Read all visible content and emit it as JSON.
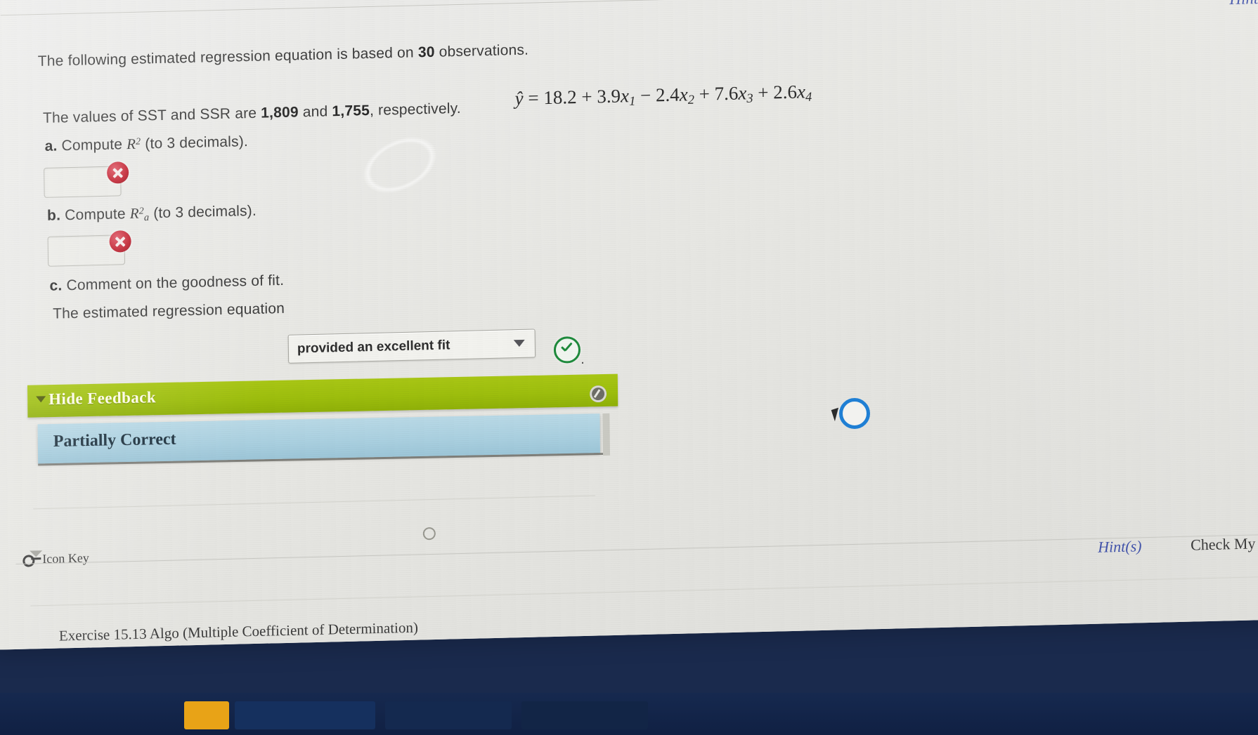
{
  "window": {
    "hint_top_label": "Hint(s)"
  },
  "problem": {
    "intro_prefix": "The following estimated regression equation is based on ",
    "observations": "30",
    "intro_suffix": " observations.",
    "equation": "ŷ = 18.2 + 3.9x₁ − 2.4x₂ + 7.6x₃ + 2.6x₄",
    "equation_parts": {
      "lhs": "ŷ",
      "intercept": "18.2",
      "b1": "3.9",
      "b2": "-2.4",
      "b3": "7.6",
      "b4": "2.6"
    },
    "sst_ssr_prefix": "The values of SST and SSR are ",
    "sst": "1,809",
    "sst_ssr_mid": " and ",
    "ssr": "1,755",
    "sst_ssr_suffix": ", respectively."
  },
  "parts": {
    "a": {
      "letter": "a.",
      "prompt_before": "Compute ",
      "symbol": "R2",
      "prompt_after": " (to 3 decimals).",
      "answer_value": "",
      "status_icon": "red-x-icon"
    },
    "b": {
      "letter": "b.",
      "prompt_before": "Compute ",
      "symbol": "R2a",
      "prompt_after": " (to 3 decimals).",
      "answer_value": "",
      "status_icon": "red-x-icon"
    },
    "c": {
      "letter": "c.",
      "prompt": "Comment on the goodness of fit.",
      "sentence_prefix": "The estimated regression equation",
      "sentence_suffix": ".",
      "dropdown_value": "provided an excellent fit",
      "status_icon": "green-check-icon"
    }
  },
  "feedback": {
    "toggle_label": "Hide Feedback",
    "status_label": "Partially Correct"
  },
  "footer": {
    "icon_key_label": "Icon Key",
    "hint_label": "Hint(s)",
    "check_label": "Check My Work",
    "exercise_title": "Exercise 15.13 Algo (Multiple Coefficient of Determination)"
  },
  "colors": {
    "feedback_green": "#9dbe0d",
    "feedback_blue": "#a9cfdf",
    "link_blue": "#3c4ea8",
    "error_red": "#c0202f",
    "success_green": "#1e8a3c",
    "page_bg": "#e9e9e5",
    "taskbar": "#12203f"
  }
}
